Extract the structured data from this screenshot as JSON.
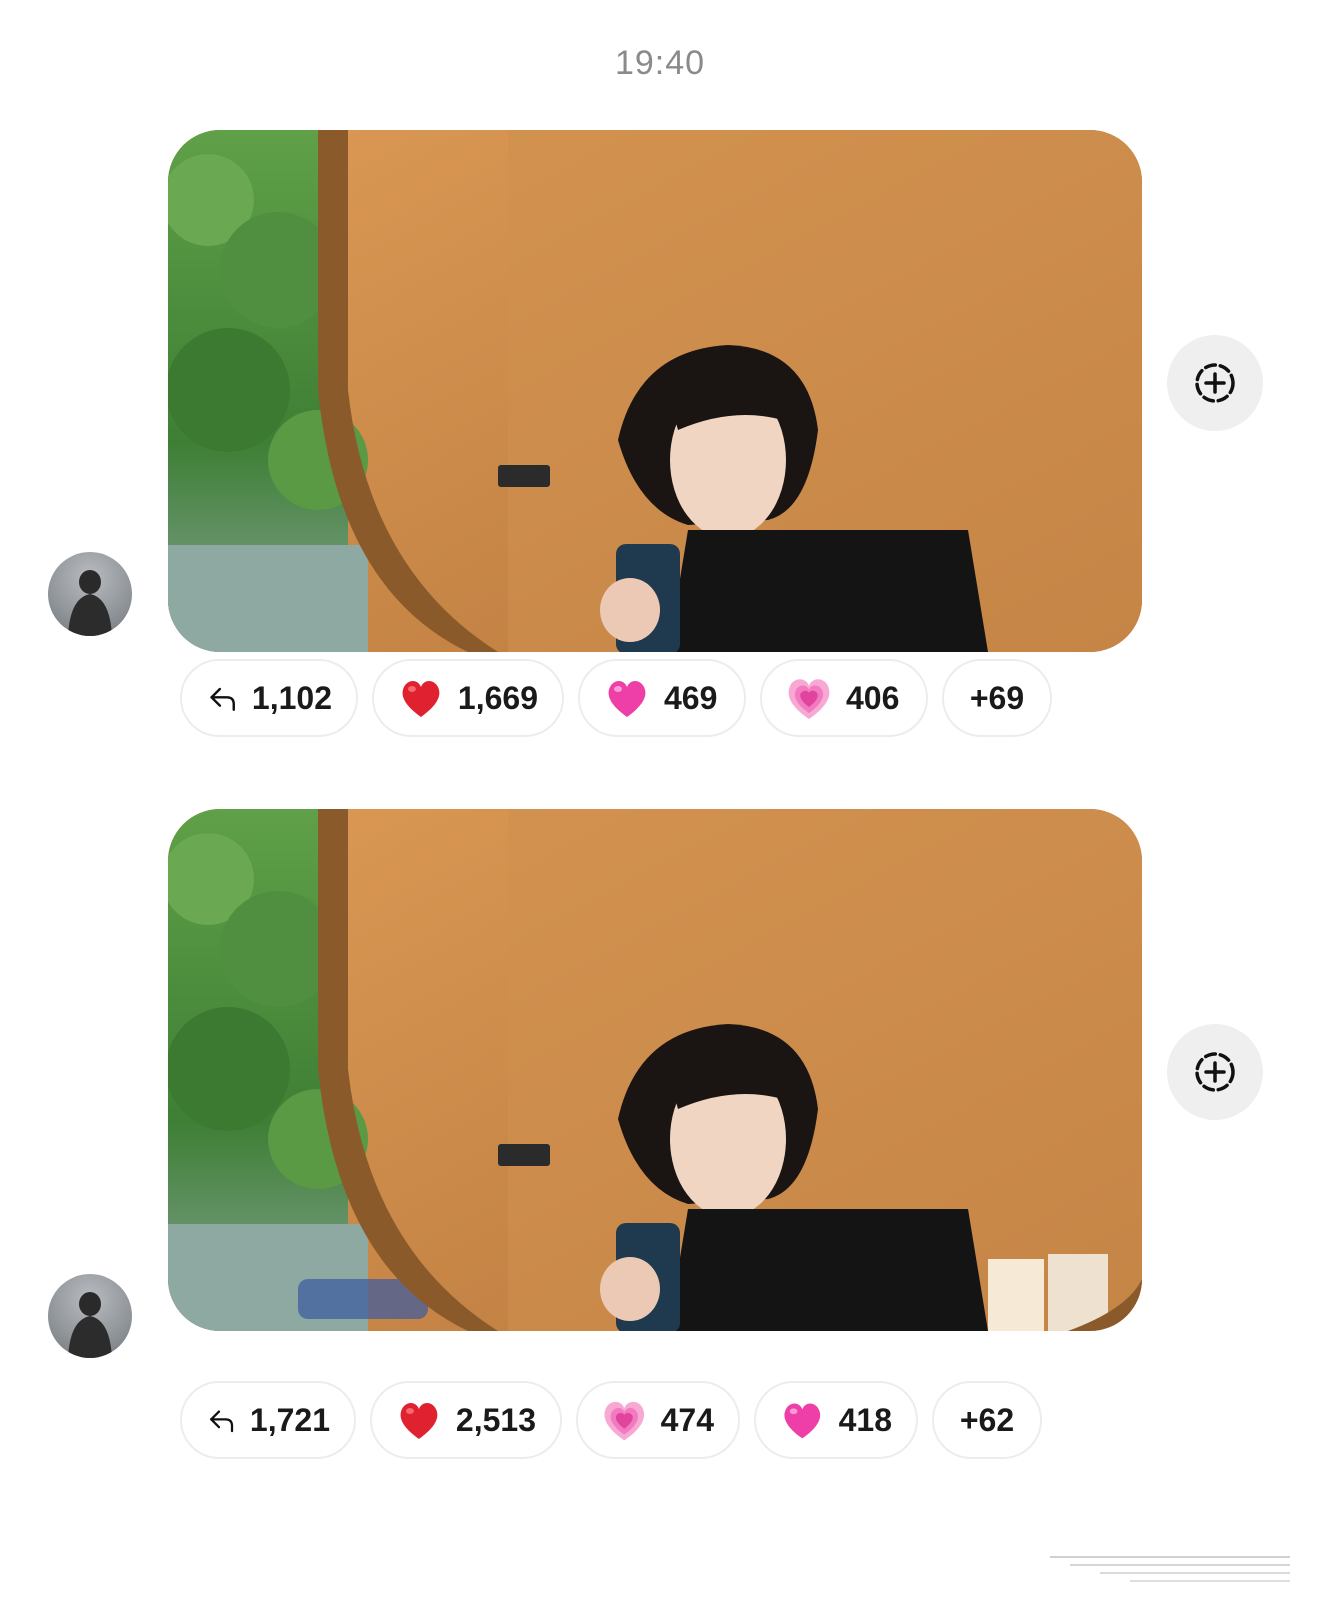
{
  "timestamp": "19:40",
  "messages": [
    {
      "reactions": [
        {
          "icon": "reply-icon",
          "count": "1,102"
        },
        {
          "icon": "red-heart-icon",
          "count": "1,669"
        },
        {
          "icon": "pink-heart-icon",
          "count": "469"
        },
        {
          "icon": "growing-heart-icon",
          "count": "406"
        },
        {
          "icon": "more",
          "count": "+69"
        }
      ]
    },
    {
      "reactions": [
        {
          "icon": "reply-icon",
          "count": "1,721"
        },
        {
          "icon": "red-heart-icon",
          "count": "2,513"
        },
        {
          "icon": "growing-heart-icon",
          "count": "474"
        },
        {
          "icon": "pink-heart-icon",
          "count": "418"
        },
        {
          "icon": "more",
          "count": "+62"
        }
      ]
    }
  ],
  "colors": {
    "timestamp": "#8a8a8a",
    "red_heart": "#e0212f",
    "pink_heart": "#ee3fa8",
    "growing_heart": "#f27ac0",
    "pill_border": "#ececec",
    "share_bg": "#efefef"
  }
}
